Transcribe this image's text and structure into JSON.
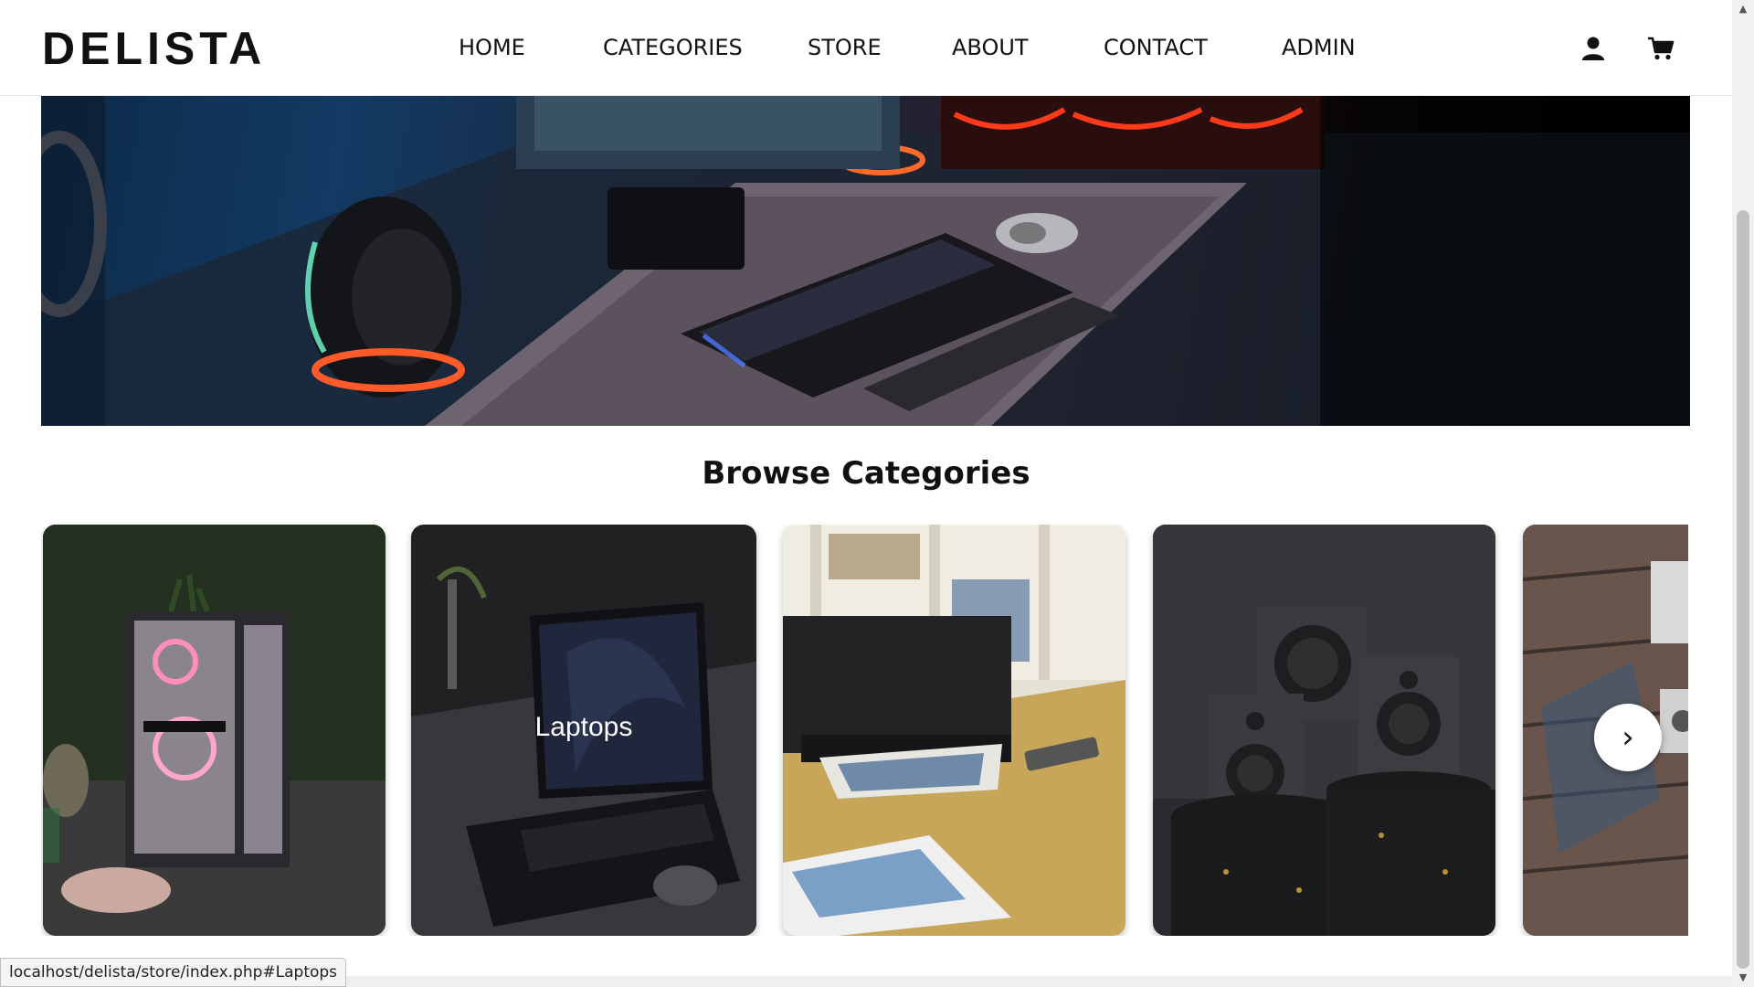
{
  "brand": {
    "logo": "DELISTA"
  },
  "nav": {
    "items": [
      "HOME",
      "CATEGORIES",
      "STORE",
      "ABOUT",
      "CONTACT",
      "ADMIN"
    ]
  },
  "header_icons": {
    "account": "user-icon",
    "cart": "cart-icon"
  },
  "hero": {
    "image": "gaming-desk-setup-photo"
  },
  "section": {
    "title": "Browse Categories"
  },
  "categories": [
    {
      "label": "",
      "image": "pc-case-photo"
    },
    {
      "label": "Laptops",
      "image": "laptop-photo",
      "hovered": true
    },
    {
      "label": "",
      "image": "printer-photo"
    },
    {
      "label": "",
      "image": "speakers-photo"
    },
    {
      "label": "",
      "image": "camera-photo"
    }
  ],
  "carousel": {
    "next_label": "›"
  },
  "status_bar": {
    "url": "localhost/delista/store/index.php#Laptops"
  },
  "colors": {
    "text": "#111111",
    "background": "#ffffff",
    "status_bg": "#f4f4f4"
  }
}
